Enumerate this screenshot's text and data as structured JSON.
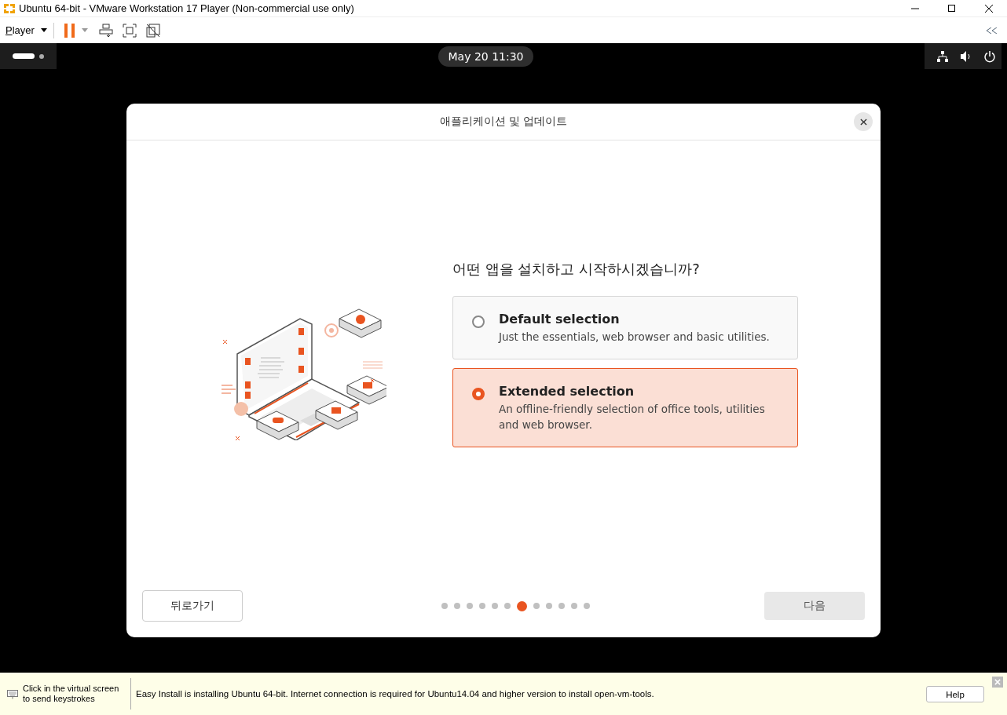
{
  "window": {
    "title": "Ubuntu 64-bit - VMware Workstation 17 Player (Non-commercial use only)"
  },
  "toolbar": {
    "menu": "Player"
  },
  "top_bar": {
    "clock": "May 20  11:30"
  },
  "dialog": {
    "title": "애플리케이션 및 업데이트",
    "question": "어떤 앱을 설치하고 시작하시겠습니까?",
    "options": [
      {
        "title": "Default selection",
        "description": "Just the essentials, web browser and basic utilities.",
        "selected": false
      },
      {
        "title": "Extended selection",
        "description": "An offline-friendly selection of office tools, utilities and web browser.",
        "selected": true
      }
    ],
    "back_button": "뒤로가기",
    "next_button": "다음",
    "steps": [
      {
        "selected": false
      },
      {
        "selected": false
      },
      {
        "selected": false
      },
      {
        "selected": false
      },
      {
        "selected": false
      },
      {
        "selected": false
      },
      {
        "selected": true
      },
      {
        "selected": false
      },
      {
        "selected": false
      },
      {
        "selected": false
      },
      {
        "selected": false
      },
      {
        "selected": false
      }
    ]
  },
  "status_bar": {
    "hint": "Click in the virtual screen to send keystrokes",
    "message": "Easy Install is installing Ubuntu 64-bit. Internet connection is required for Ubuntu14.04 and higher version to install open-vm-tools.",
    "help_button": "Help"
  }
}
